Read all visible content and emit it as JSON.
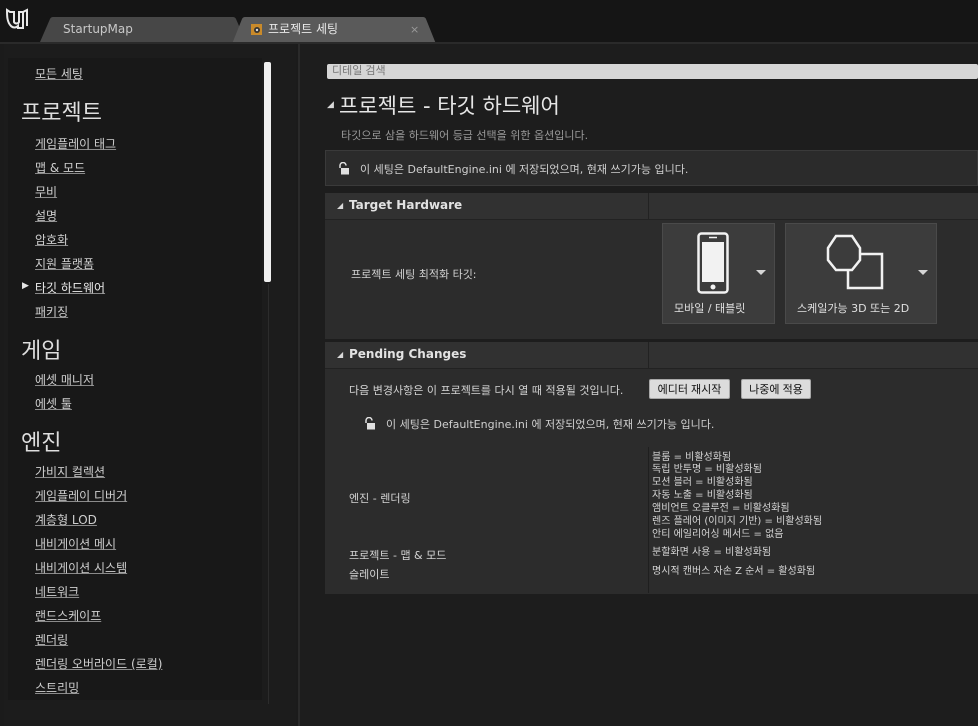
{
  "tabs": [
    {
      "label": "StartupMap"
    },
    {
      "label": "프로젝트 세팅",
      "close": "×"
    }
  ],
  "search": {
    "placeholder": "디테일 검색"
  },
  "sidebar": {
    "all_settings": "모든 세팅",
    "categories": [
      {
        "title": "프로젝트",
        "items": [
          "게임플레이 태그",
          "맵 & 모드",
          "무비",
          "설명",
          "암호화",
          "지원 플랫폼",
          "타깃 하드웨어",
          "패키징"
        ]
      },
      {
        "title": "게임",
        "items": [
          "에셋 매니저",
          "에셋 툴"
        ]
      },
      {
        "title": "엔진",
        "items": [
          "가비지 컬렉션",
          "게임플레이 디버거",
          "계층형 LOD",
          "내비게이션 메시",
          "내비게이션 시스템",
          "네트워크",
          "랜드스케이프",
          "렌더링",
          "렌더링 오버라이드 (로컬)",
          "스트리밍"
        ]
      }
    ],
    "selected": "타깃 하드웨어"
  },
  "page": {
    "title": "프로젝트 - 타깃 하드웨어",
    "description": "타깃으로 삼을 하드웨어 등급 선택을 위한 옵션입니다.",
    "notice": "이 세팅은 DefaultEngine.ini 에 저장되었으며, 현재 쓰기가능 입니다."
  },
  "target_hardware": {
    "header": "Target Hardware",
    "label": "프로젝트 세팅 최적화 타깃:",
    "platform_option": "모바일 / 태블릿",
    "graphics_option": "스케일가능 3D 또는 2D"
  },
  "pending": {
    "header": "Pending Changes",
    "message": "다음 변경사항은 이 프로젝트를 다시 열 때 적용될 것입니다.",
    "restart_button": "에디터 재시작",
    "later_button": "나중에 적용",
    "notice": "이 세팅은 DefaultEngine.ini 에 저장되었으며, 현재 쓰기가능 입니다.",
    "rows": [
      {
        "label": "엔진 - 렌더링",
        "values": [
          "블룸 = 비활성화됨",
          "독립 반투명 = 비활성화됨",
          "모션 블러 = 비활성화됨",
          "자동 노출 = 비활성화됨",
          "앰비언트 오클루전 = 비활성화됨",
          "렌즈 플레어 (이미지 기반) = 비활성화됨",
          "안티 에일리어싱 메서드 = 없음"
        ]
      },
      {
        "label": "프로젝트 - 맵 & 모드",
        "values": [
          "분할화면 사용 = 비활성화됨"
        ]
      },
      {
        "label": "슬레이트",
        "values": [
          "명시적 캔버스 자손 Z 순서 = 활성화됨"
        ]
      }
    ]
  },
  "colors": {
    "background": "#1b1b1b",
    "panel": "#2c2c2c",
    "button": "#dcdcdc"
  }
}
